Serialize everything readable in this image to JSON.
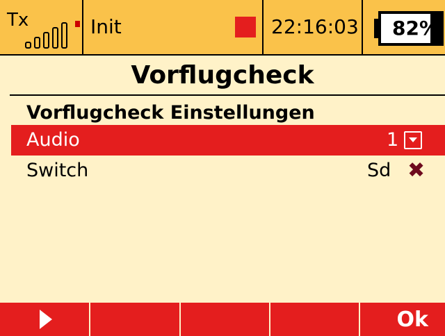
{
  "status_bar": {
    "tx_label": "Tx",
    "signal_strength_bars": 4,
    "model_name": "Init",
    "time": "22:16:03",
    "battery_percent": "82%",
    "battery_level": 0.82,
    "colors": {
      "bar": "#fac24a",
      "recording": "#e41e1e"
    }
  },
  "page": {
    "title": "Vorflugcheck",
    "section_header": "Vorflugcheck Einstellungen"
  },
  "settings": [
    {
      "label": "Audio",
      "value": "1",
      "control": "dropdown",
      "selected": true
    },
    {
      "label": "Switch",
      "value": "Sd",
      "control": "clear-x",
      "selected": false
    }
  ],
  "softkeys": [
    {
      "icon": "play-icon",
      "label": ""
    },
    {
      "label": ""
    },
    {
      "label": ""
    },
    {
      "label": ""
    },
    {
      "label": "Ok"
    }
  ],
  "colors": {
    "background": "#fff2c8",
    "highlight": "#e41e1e",
    "x_icon": "#6e0a1e"
  }
}
